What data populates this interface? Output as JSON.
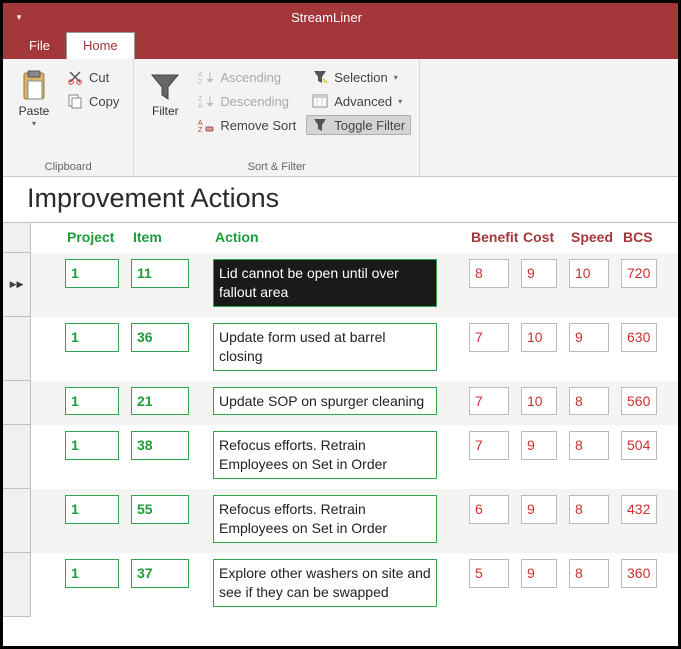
{
  "app_title": "StreamLiner",
  "tabs": {
    "file": "File",
    "home": "Home"
  },
  "ribbon": {
    "clipboard": {
      "paste": "Paste",
      "cut": "Cut",
      "copy": "Copy",
      "group_label": "Clipboard"
    },
    "sortfilter": {
      "filter": "Filter",
      "asc": "Ascending",
      "desc": "Descending",
      "remove": "Remove Sort",
      "selection": "Selection",
      "advanced": "Advanced",
      "toggle": "Toggle Filter",
      "group_label": "Sort & Filter"
    }
  },
  "page_title": "Improvement Actions",
  "columns": {
    "project": "Project",
    "item": "Item",
    "action": "Action",
    "benefit": "Benefit",
    "cost": "Cost",
    "speed": "Speed",
    "bcs": "BCS"
  },
  "rows": [
    {
      "project": "1",
      "item": "11",
      "action": "Lid cannot be open until over fallout area",
      "benefit": "8",
      "cost": "9",
      "speed": "10",
      "bcs": "720",
      "highlight": true
    },
    {
      "project": "1",
      "item": "36",
      "action": "Update form used at barrel closing",
      "benefit": "7",
      "cost": "10",
      "speed": "9",
      "bcs": "630"
    },
    {
      "project": "1",
      "item": "21",
      "action": "Update SOP on spurger cleaning",
      "benefit": "7",
      "cost": "10",
      "speed": "8",
      "bcs": "560"
    },
    {
      "project": "1",
      "item": "38",
      "action": "Refocus efforts. Retrain Employees on Set in Order",
      "benefit": "7",
      "cost": "9",
      "speed": "8",
      "bcs": "504"
    },
    {
      "project": "1",
      "item": "55",
      "action": "Refocus efforts. Retrain Employees on Set in Order",
      "benefit": "6",
      "cost": "9",
      "speed": "8",
      "bcs": "432"
    },
    {
      "project": "1",
      "item": "37",
      "action": "Explore other washers on site and see if they can be swapped",
      "benefit": "5",
      "cost": "9",
      "speed": "8",
      "bcs": "360"
    }
  ]
}
